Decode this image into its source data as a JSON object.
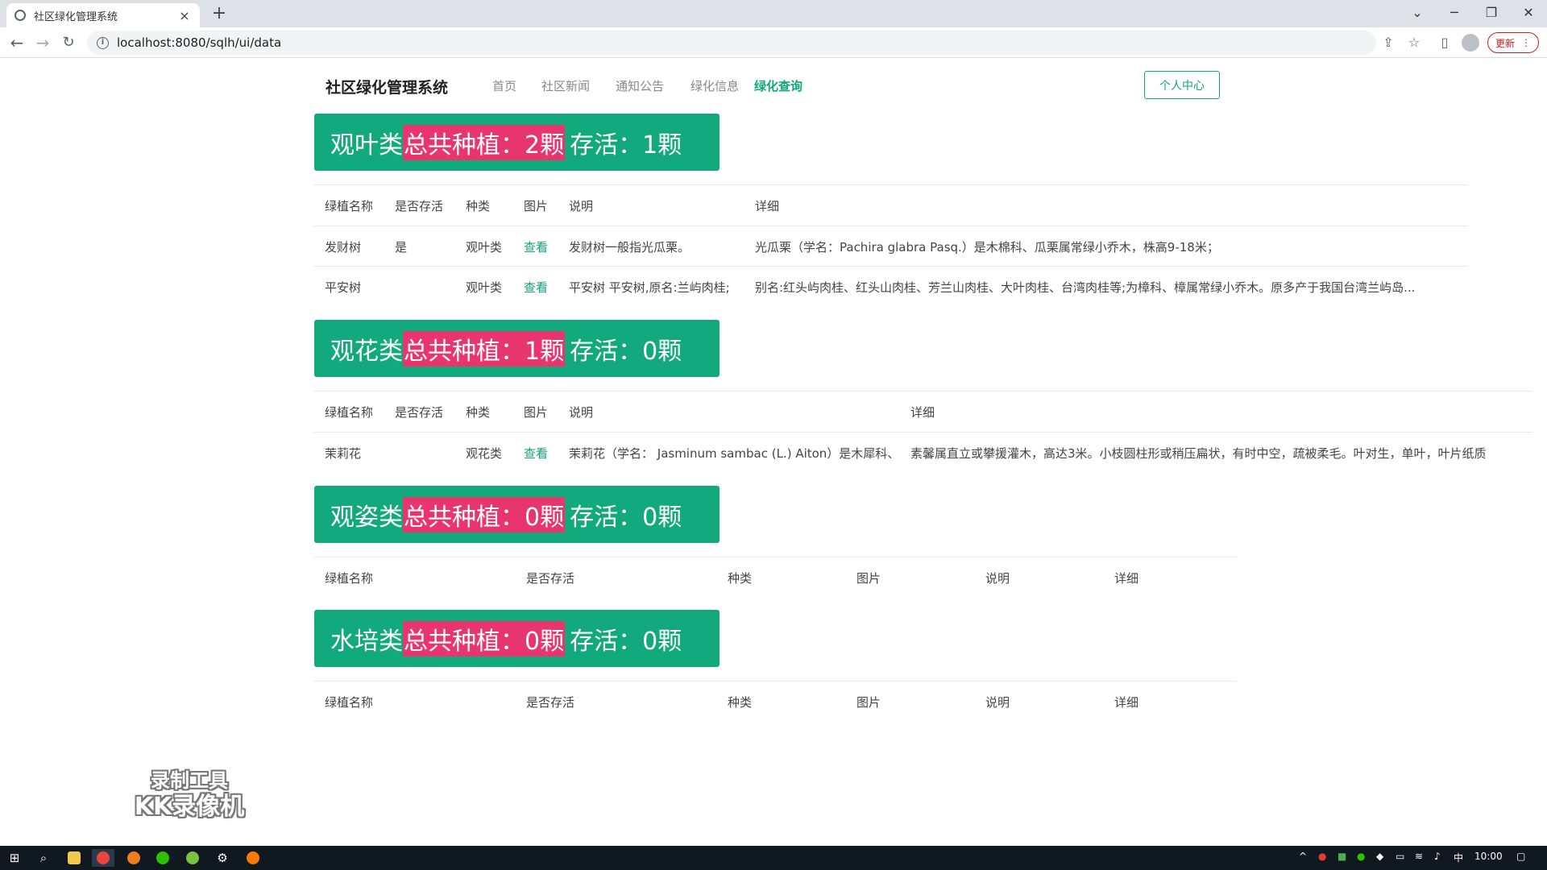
{
  "browser": {
    "tab_title": "社区绿化管理系统",
    "new_tab": "+",
    "url": "localhost:8080/sqlh/ui/data",
    "update_label": "更新"
  },
  "navbar": {
    "brand": "社区绿化管理系统",
    "links": [
      "首页",
      "社区新闻",
      "通知公告",
      "绿化信息",
      "绿化查询"
    ],
    "active_link": "绿化查询",
    "personal_center": "个人中心"
  },
  "sections": [
    {
      "category": "观叶类",
      "total_label": "总共种植：",
      "total": "2颗",
      "alive_label": "存活：",
      "alive": "1颗",
      "headers": [
        "绿植名称",
        "是否存活",
        "种类",
        "图片",
        "说明",
        "详细"
      ],
      "rows": [
        [
          "发财树",
          "是",
          "观叶类",
          "查看",
          "发财树一般指光瓜栗。",
          "光瓜栗（学名：Pachira glabra Pasq.）是木棉科、瓜栗属常绿小乔木，株高9-18米；"
        ],
        [
          "平安树",
          "",
          "观叶类",
          "查看",
          "平安树 平安树,原名:兰屿肉桂;",
          "别名:红头屿肉桂、红头山肉桂、芳兰山肉桂、大叶肉桂、台湾肉桂等;为樟科、樟属常绿小乔木。原多产于我国台湾兰屿岛..."
        ]
      ]
    },
    {
      "category": "观花类",
      "total_label": "总共种植：",
      "total": "1颗",
      "alive_label": "存活：",
      "alive": "0颗",
      "headers": [
        "绿植名称",
        "是否存活",
        "种类",
        "图片",
        "说明",
        "详细"
      ],
      "rows": [
        [
          "茉莉花",
          "",
          "观花类",
          "查看",
          "茉莉花（学名： Jasminum sambac (L.) Aiton）是木犀科、",
          "素馨属直立或攀援灌木，高达3米。小枝圆柱形或稍压扁状，有时中空，疏被柔毛。叶对生，单叶，叶片纸质"
        ]
      ]
    },
    {
      "category": "观姿类",
      "total_label": "总共种植：",
      "total": "0颗",
      "alive_label": "存活：",
      "alive": "0颗",
      "headers": [
        "绿植名称",
        "是否存活",
        "种类",
        "图片",
        "说明",
        "详细"
      ],
      "rows": []
    },
    {
      "category": "水培类",
      "total_label": "总共种植：",
      "total": "0颗",
      "alive_label": "存活：",
      "alive": "0颗",
      "headers": [
        "绿植名称",
        "是否存活",
        "种类",
        "图片",
        "说明",
        "详细"
      ],
      "rows": []
    }
  ],
  "watermark": {
    "line1": "录制工具",
    "line2": "KK录像机"
  },
  "taskbar": {
    "ime": "中",
    "clock": "10:00"
  },
  "colors": {
    "accent_green": "#12a97c",
    "highlight_pink": "#e8356d",
    "link_green": "#12a67a"
  }
}
